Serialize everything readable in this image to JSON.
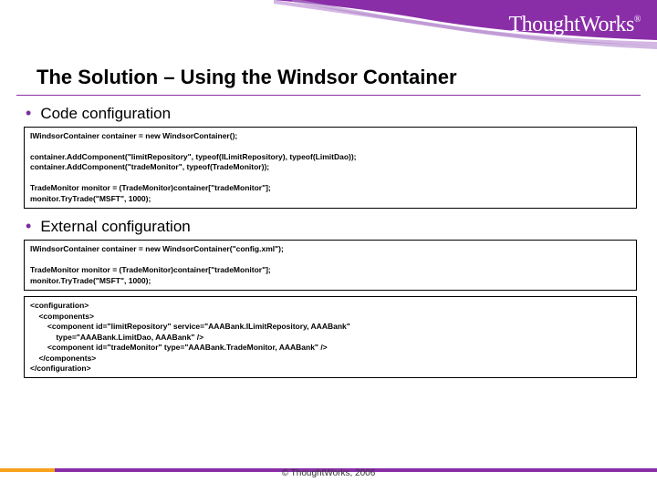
{
  "brand": {
    "part1": "Thought",
    "part2": "Works",
    "reg": "®"
  },
  "title": "The Solution – Using the Windsor Container",
  "bullets": {
    "code_cfg": "Code configuration",
    "ext_cfg": "External configuration"
  },
  "code1": "IWindsorContainer container = new WindsorContainer();\n\ncontainer.AddComponent(\"limitRepository\", typeof(ILimitRepository), typeof(LimitDao));\ncontainer.AddComponent(\"tradeMonitor\", typeof(TradeMonitor));\n\nTradeMonitor monitor = (TradeMonitor)container[\"tradeMonitor\"];\nmonitor.TryTrade(\"MSFT\", 1000);",
  "code2": "IWindsorContainer container = new WindsorContainer(\"config.xml\");\n\nTradeMonitor monitor = (TradeMonitor)container[\"tradeMonitor\"];\nmonitor.TryTrade(\"MSFT\", 1000);",
  "code3": "<configuration>\n    <components>\n        <component id=\"limitRepository\" service=\"AAABank.ILimitRepository, AAABank\"\n            type=\"AAABank.LimitDao, AAABank\" />\n        <component id=\"tradeMonitor\" type=\"AAABank.TradeMonitor, AAABank\" />\n    </components>\n</configuration>",
  "footer": "© ThoughtWorks, 2006",
  "colors": {
    "purple": "#8a2ea8",
    "orange": "#f8a11c"
  }
}
